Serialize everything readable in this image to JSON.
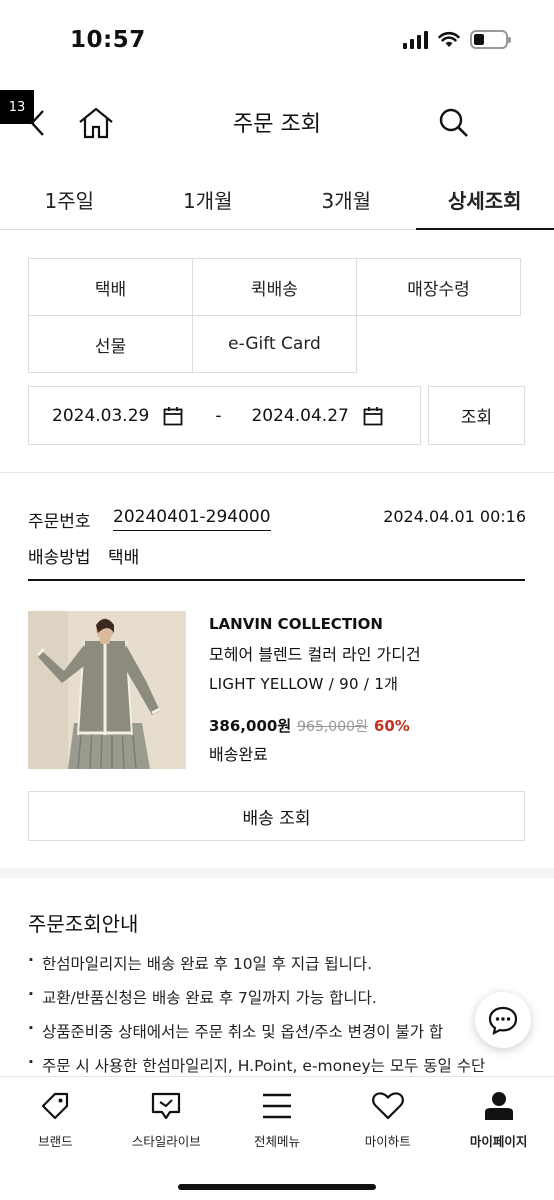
{
  "status_bar": {
    "time": "10:57"
  },
  "header": {
    "title": "주문 조회",
    "cart_count": "13"
  },
  "period_tabs": [
    {
      "label": "1주일"
    },
    {
      "label": "1개월"
    },
    {
      "label": "3개월"
    },
    {
      "label": "상세조회"
    }
  ],
  "delivery_filters": [
    {
      "label": "택배"
    },
    {
      "label": "퀵배송"
    },
    {
      "label": "매장수령"
    },
    {
      "label": "선물"
    },
    {
      "label": "e-Gift Card"
    }
  ],
  "date_range": {
    "start": "2024.03.29",
    "separator": "-",
    "end": "2024.04.27",
    "search_label": "조회"
  },
  "order": {
    "number_label": "주문번호",
    "number": "20240401-294000",
    "datetime": "2024.04.01 00:16",
    "shipping_label": "배송방법",
    "shipping_method": "택배",
    "item": {
      "brand": "LANVIN COLLECTION",
      "name": "모헤어 블렌드 컬러 라인 가디건",
      "option": "LIGHT YELLOW / 90 / 1개",
      "sale_price": "386,000원",
      "original_price": "965,000원",
      "discount": "60%",
      "status": "배송완료"
    },
    "track_button": "배송 조회"
  },
  "guide": {
    "title": "주문조회안내",
    "items": [
      "한섬마일리지는 배송 완료 후 10일 후 지급 됩니다.",
      "교환/반품신청은 배송 완료 후 7일까지 가능 합니다.",
      "상품준비중 상태에서는 주문 취소 및 옵션/주소 변경이 불가 합",
      "주문 시 사용한 한섬마일리지, H.Point, e-money는 모두 동일 수단"
    ]
  },
  "bottom_nav": [
    {
      "label": "브랜드",
      "icon": "tag-icon"
    },
    {
      "label": "스타일라이브",
      "icon": "live-chat-icon"
    },
    {
      "label": "전체메뉴",
      "icon": "menu-icon"
    },
    {
      "label": "마이하트",
      "icon": "heart-icon"
    },
    {
      "label": "마이페이지",
      "icon": "person-icon"
    }
  ]
}
